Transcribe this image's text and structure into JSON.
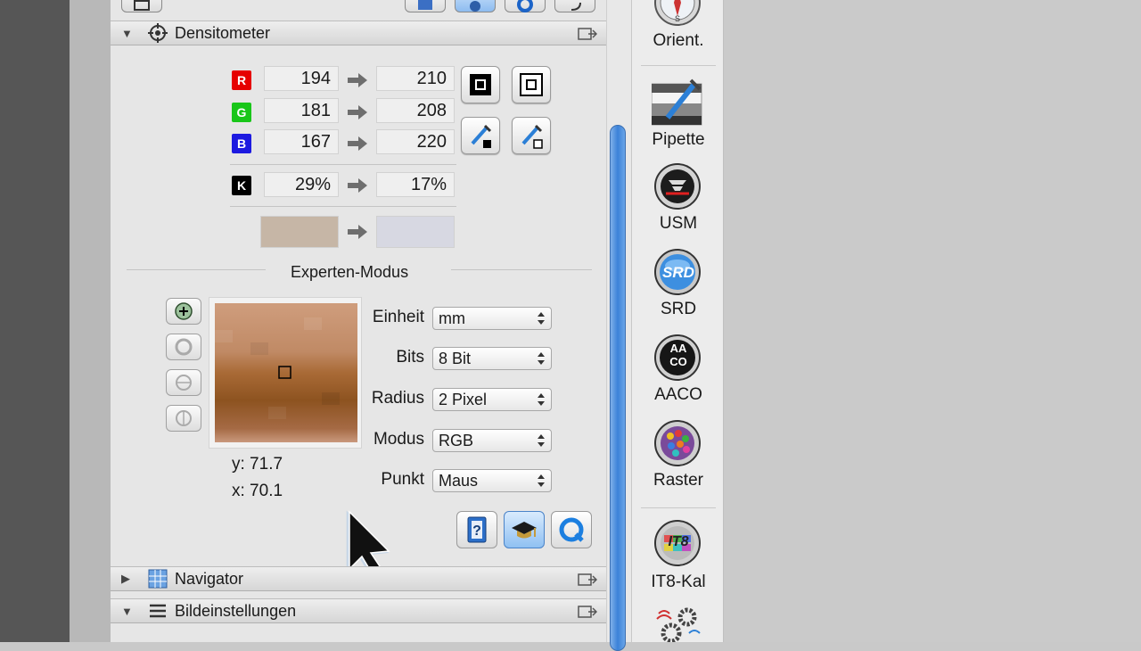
{
  "densitometer": {
    "title": "Densitometer",
    "rows": [
      {
        "channel": "R",
        "color": "#e60000",
        "in": "194",
        "out": "210"
      },
      {
        "channel": "G",
        "color": "#19c619",
        "in": "181",
        "out": "208"
      },
      {
        "channel": "B",
        "color": "#1d1ae0",
        "in": "167",
        "out": "220"
      }
    ],
    "k_row": {
      "channel": "K",
      "color": "#000000",
      "in": "29%",
      "out": "17%"
    },
    "swatch_in_color": "#c6b6a6",
    "swatch_out_color": "#d7d8e2"
  },
  "expert": {
    "label": "Experten-Modus",
    "settings": [
      {
        "label": "Einheit",
        "value": "mm"
      },
      {
        "label": "Bits",
        "value": "8 Bit"
      },
      {
        "label": "Radius",
        "value": "2 Pixel"
      },
      {
        "label": "Modus",
        "value": "RGB"
      },
      {
        "label": "Punkt",
        "value": "Maus"
      }
    ],
    "coords": {
      "y": "y: 71.7",
      "x": "x: 70.1"
    }
  },
  "sections": {
    "navigator": "Navigator",
    "bildeinstellungen": "Bildeinstellungen"
  },
  "toolstrip": {
    "items": [
      "Orient.",
      "Pipette",
      "USM",
      "SRD",
      "AACO",
      "Raster",
      "IT8-Kal"
    ],
    "srd_badge": "SRD",
    "aaco_badge_top": "AA",
    "aaco_badge_bottom": "CO",
    "it8_badge": "IT8"
  },
  "colors": {
    "accent_blue": "#3b82d8",
    "panel_bg": "#e6e6e6"
  }
}
